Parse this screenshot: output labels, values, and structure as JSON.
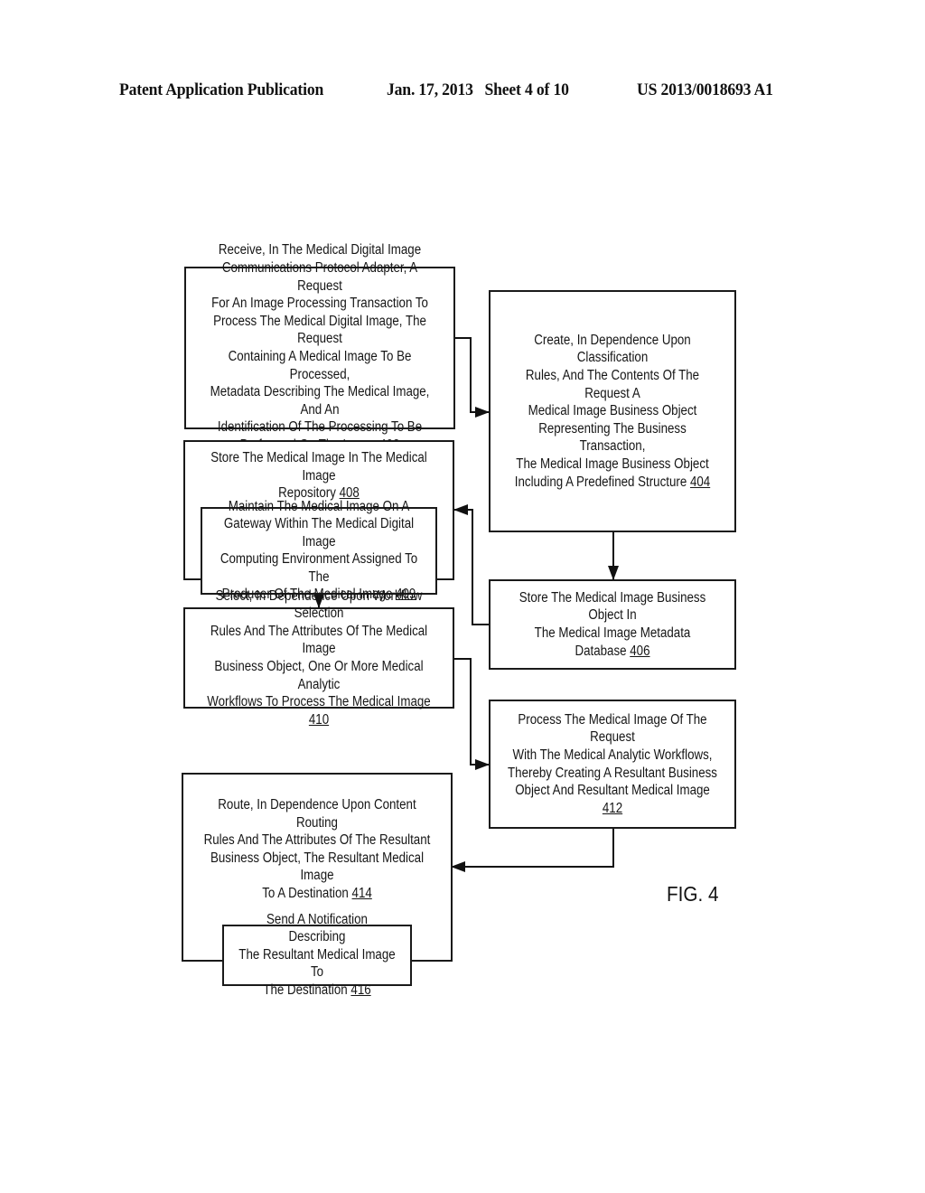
{
  "header": {
    "publication": "Patent Application Publication",
    "date_sheet": "Jan. 17, 2013   Sheet 4 of 10",
    "patent_number": "US 2013/0018693 A1"
  },
  "figure_label": "FIG. 4",
  "steps": {
    "s402": {
      "text": "Receive, In The Medical Digital Image\nCommunications Protocol Adapter, A Request\nFor An Image Processing Transaction To\nProcess The Medical Digital Image, The Request\nContaining A Medical Image To Be Processed,\nMetadata Describing The Medical Image, And An\nIdentification Of The Processing To Be\nPerformed On The Image ",
      "ref": "402"
    },
    "s404": {
      "text": "Create, In Dependence Upon Classification\nRules, And The Contents Of The Request A\nMedical Image Business Object\nRepresenting The Business Transaction,\nThe Medical Image Business Object\nIncluding A Predefined Structure  ",
      "ref": "404"
    },
    "s406": {
      "text": "Store The Medical Image Business Object In\nThe Medical Image Metadata Database ",
      "ref": "406"
    },
    "s408": {
      "text": "Store The Medical Image In The Medical Image\nRepository  ",
      "ref": "408"
    },
    "s409": {
      "text": "Maintain The Medical Image On A\nGateway Within The Medical Digital Image\nComputing Environment Assigned To The\nProducer Of The Medical Image  ",
      "ref": "409"
    },
    "s410": {
      "text": "Select, In Dependence Upon Workflow Selection\nRules And The Attributes Of The Medical Image\nBusiness Object, One Or More Medical Analytic\nWorkflows To Process The Medical Image ",
      "ref": "410"
    },
    "s412": {
      "text": "Process The Medical Image Of The Request\nWith The Medical Analytic Workflows,\nThereby Creating A Resultant Business\nObject And Resultant Medical Image ",
      "ref": "412"
    },
    "s414": {
      "text": "Route, In Dependence Upon Content Routing\nRules And The Attributes Of The Resultant\nBusiness Object, The Resultant Medical Image\nTo A Destination  ",
      "ref": "414"
    },
    "s416": {
      "text": "Send A Notification Describing\nThe Resultant Medical Image To\nThe Destination ",
      "ref": "416"
    }
  },
  "flow": [
    {
      "from": "402",
      "to": "404"
    },
    {
      "from": "404",
      "to": "406"
    },
    {
      "from": "406",
      "to": "408"
    },
    {
      "from": "408",
      "to": "410"
    },
    {
      "from": "410",
      "to": "412"
    },
    {
      "from": "412",
      "to": "414"
    }
  ]
}
